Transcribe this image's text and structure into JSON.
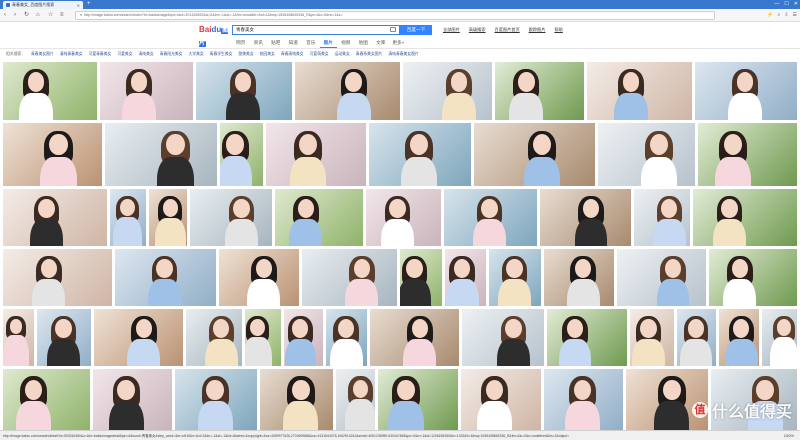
{
  "browser": {
    "tab_title": "青春美女_百度图片搜索",
    "new_tab": "+",
    "url": "http://image.baidu.com/search/index?tn=baiduimage&ipn=r&ct=201326592&cl=2&lm=-1&st=-1&fm=result&fr=&sf=1&fmq=1535408845336_R&pv=&ic=0&nc=1&z=",
    "zoom": "100%",
    "status_url": "http://image.baidu.com/search/detail?ct=503316480&z=&tn=baiduimagedetail&ipn=d&word=青春美女&step_word=&ie=utf-8&in=&cl=2&lm=-1&st=-1&hd=&latest=&copyright=&cs=4059977626,2702609886&os=4131544378,1062914241&simid=4061236959,630447485&pn=0&rn=1&di=1206155280&ln=1332&fr=&fmq=1535408845336_R&fm=&ic=0&s=undefined&hs=2&objurl="
  },
  "header": {
    "logo_bai": "Bai",
    "logo_paw": "du",
    "logo_img": "图片",
    "search_value": "青春美女",
    "search_button": "百度一下",
    "links": [
      "全部图片",
      "高级搜索",
      "百度图片首页",
      "跟踪图片",
      "帮助"
    ]
  },
  "nav_tabs": [
    "网页",
    "资讯",
    "贴吧",
    "知道",
    "音乐",
    "图片",
    "视频",
    "地图",
    "文库",
    "更多»"
  ],
  "active_tab": "图片",
  "related": {
    "label": "相关搜索：",
    "items": [
      "青春美女图片",
      "清纯青春美女",
      "可爱青春美女",
      "可爱美女",
      "清纯美女",
      "青春阳光美女",
      "大学美女",
      "青春学生美女",
      "甜美美女",
      "校园美女",
      "青春清纯美女",
      "可爱萌美女",
      "运动美女",
      "青春系美女图片",
      "清纯青春美女图片"
    ]
  },
  "colors": {
    "accent": "#3385ff",
    "titlebar": "#3a78d0"
  },
  "watermark": {
    "badge": "值",
    "text": "什么值得买"
  }
}
